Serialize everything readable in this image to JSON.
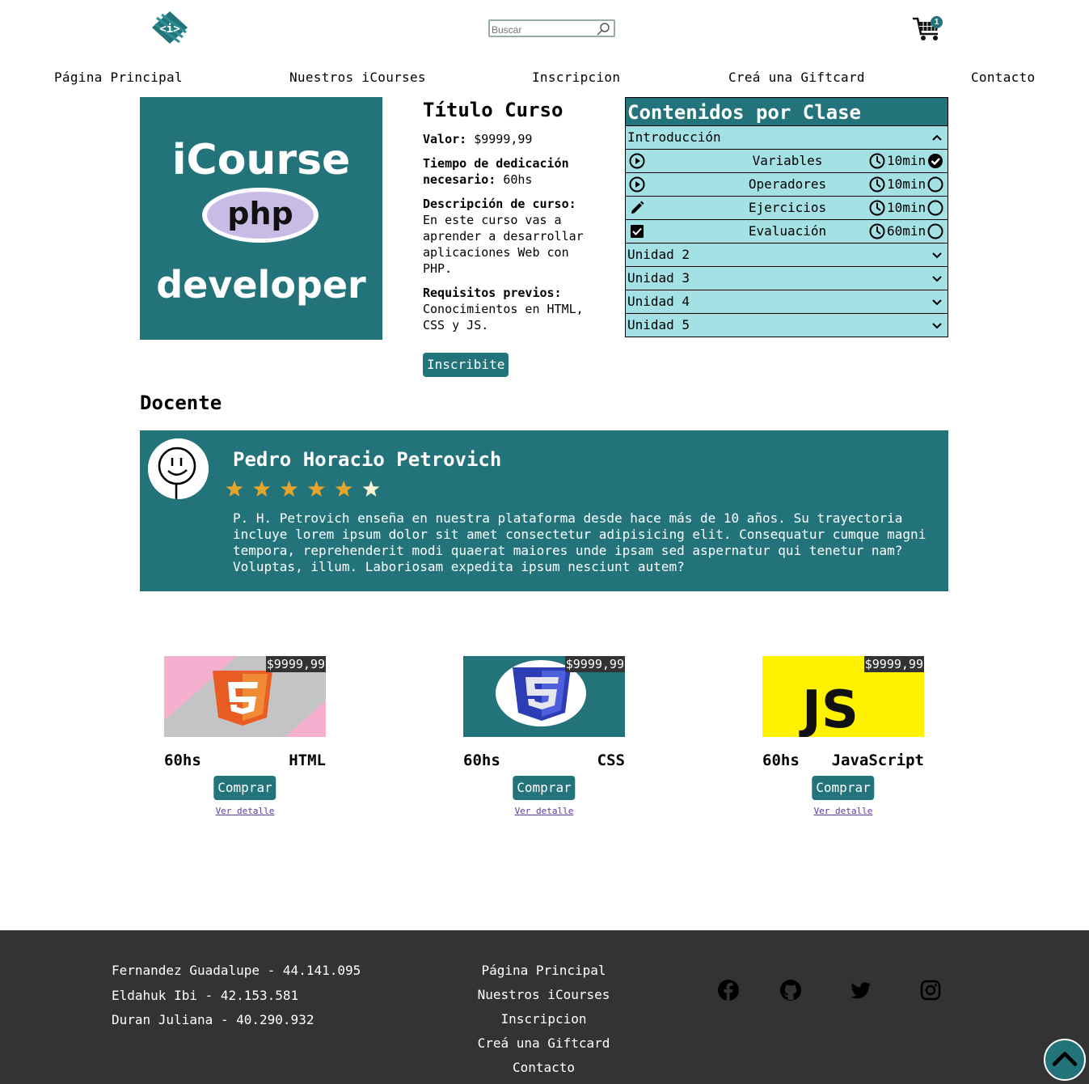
{
  "header": {
    "search_placeholder": "Buscar",
    "cart_count": "1"
  },
  "nav": [
    "Página Principal",
    "Nuestros iCourses",
    "Inscripcion",
    "Creá una Giftcard",
    "Contacto"
  ],
  "course": {
    "image_text": [
      "iCourse",
      "php",
      "developer"
    ],
    "title": "Título Curso",
    "price_label": "Valor:",
    "price": "$9999,99",
    "time_label": "Tiempo de dedicación necesario:",
    "time": "60hs",
    "desc_label": "Descripción de curso:",
    "desc": "En este curso vas a aprender a desarrollar aplicaciones Web con PHP.",
    "req_label": "Requisitos previos:",
    "req": "Conocimientos en HTML, CSS y JS.",
    "enroll": "Inscribite"
  },
  "contents": {
    "title": "Contenidos por Clase",
    "intro": "Introducción",
    "lessons": [
      {
        "name": "Variables",
        "duration": "10min",
        "icon": "play-icon",
        "done": true
      },
      {
        "name": "Operadores",
        "duration": "10min",
        "icon": "play-icon",
        "done": false
      },
      {
        "name": "Ejercicios",
        "duration": "10min",
        "icon": "pencil-icon",
        "done": false
      },
      {
        "name": "Evaluación",
        "duration": "60min",
        "icon": "checkbox-icon",
        "done": false
      }
    ],
    "units": [
      "Unidad 2",
      "Unidad 3",
      "Unidad 4",
      "Unidad 5"
    ]
  },
  "teacher": {
    "section_title": "Docente",
    "name": "Pedro Horacio Petrovich",
    "rating_stars": 5,
    "rating_max": 6,
    "bio": "P. H. Petrovich enseña en nuestra plataforma desde hace más de 10 años. Su trayectoria incluye lorem ipsum dolor sit amet consectetur adipisicing elit. Consequatur cumque magni tempora, reprehenderit modi quaerat maiores unde ipsam sed aspernatur qui tenetur nam? Voluptas, illum. Laboriosam expedita ipsum nesciunt autem?"
  },
  "products": [
    {
      "price": "$9999,99",
      "hours": "60hs",
      "lang": "HTML",
      "buy": "Comprar",
      "detail": "Ver detalle"
    },
    {
      "price": "$9999,99",
      "hours": "60hs",
      "lang": "CSS",
      "buy": "Comprar",
      "detail": "Ver detalle"
    },
    {
      "price": "$9999,99",
      "hours": "60hs",
      "lang": "JavaScript",
      "buy": "Comprar",
      "detail": "Ver detalle",
      "logo_text": "JS"
    }
  ],
  "footer": {
    "authors": [
      "Fernandez Guadalupe - 44.141.095",
      "Eldahuk Ibi - 42.153.581",
      "Duran Juliana - 40.290.932"
    ],
    "nav": [
      "Página Principal",
      "Nuestros iCourses",
      "Inscripcion",
      "Creá una Giftcard",
      "Contacto"
    ],
    "social": [
      "facebook-icon",
      "github-icon",
      "twitter-icon",
      "instagram-icon"
    ]
  },
  "colors": {
    "primary": "#23737a",
    "accordion_bg": "#a3e1e5",
    "footer_bg": "#333333",
    "star": "#e6a52a"
  }
}
